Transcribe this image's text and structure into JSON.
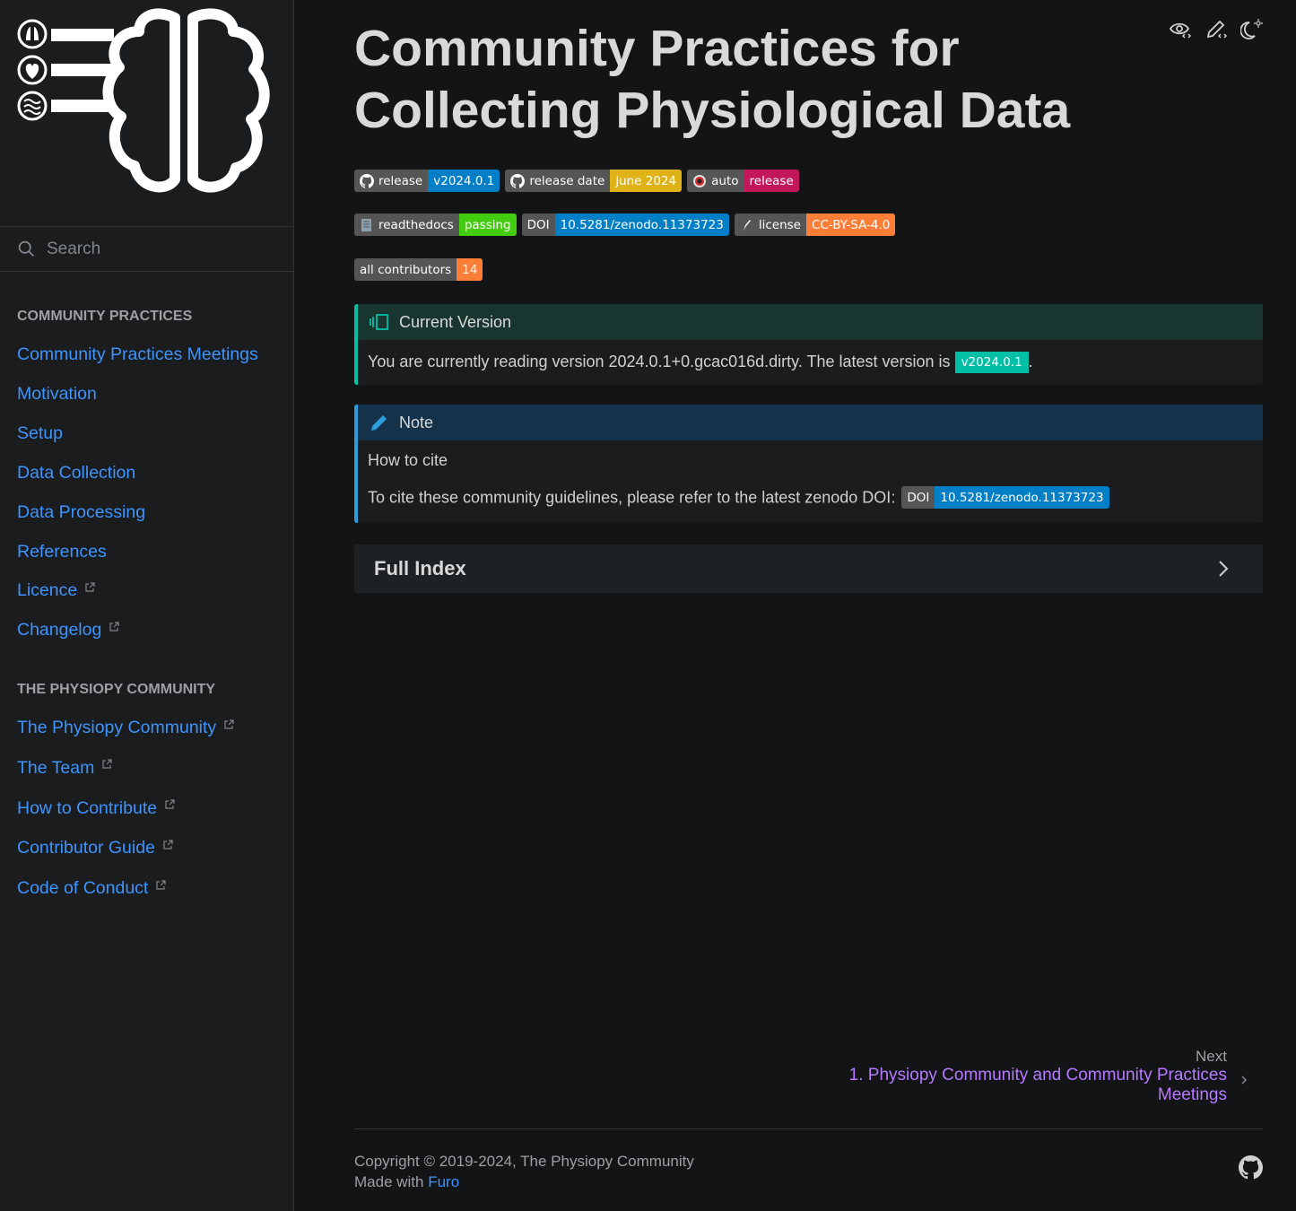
{
  "sidebar": {
    "search_placeholder": "Search",
    "caption1": "COMMUNITY PRACTICES",
    "section1": [
      {
        "label": "Community Practices Meetings",
        "external": false
      },
      {
        "label": "Motivation",
        "external": false
      },
      {
        "label": "Setup",
        "external": false
      },
      {
        "label": "Data Collection",
        "external": false
      },
      {
        "label": "Data Processing",
        "external": false
      },
      {
        "label": "References",
        "external": false
      },
      {
        "label": "Licence",
        "external": true
      },
      {
        "label": "Changelog",
        "external": true
      }
    ],
    "caption2": "THE PHYSIOPY COMMUNITY",
    "section2": [
      {
        "label": "The Physiopy Community",
        "external": true
      },
      {
        "label": "The Team",
        "external": true
      },
      {
        "label": "How to Contribute",
        "external": true
      },
      {
        "label": "Contributor Guide",
        "external": true
      },
      {
        "label": "Code of Conduct",
        "external": true
      }
    ]
  },
  "page": {
    "title_line1": "Community Practices for",
    "title_line2": "Collecting Physiological Data"
  },
  "badges": {
    "row1": [
      {
        "label": "release",
        "value": "v2024.0.1",
        "value_color": "#007ec6",
        "icon": "github-icon"
      },
      {
        "label": "release date",
        "value": "june 2024",
        "value_color": "#dfb317",
        "icon": "github-icon"
      },
      {
        "label": "auto",
        "value": "release",
        "value_color": "#c2185b",
        "icon": "auto-icon"
      }
    ],
    "row2": [
      {
        "label": "readthedocs",
        "value": "passing",
        "value_color": "#4c1",
        "icon": "readthedocs-icon"
      },
      {
        "label": "DOI",
        "value": "10.5281/zenodo.11373723",
        "value_color": "#007ec6",
        "icon": ""
      },
      {
        "label": "license",
        "value": "CC-BY-SA-4.0",
        "value_color": "#fe7d37",
        "icon": "pen-icon"
      }
    ],
    "row3": [
      {
        "label": "all contributors",
        "value": "14",
        "value_color": "#fe7d37",
        "icon": ""
      }
    ]
  },
  "current_version": {
    "title": "Current Version",
    "text": "You are currently reading version 2024.0.1+0.gcac016d.dirty. The latest version is ",
    "tag": "v2024.0.1",
    "trailing": ".",
    "accent": "#00bfa5",
    "header_bg": "#18362f"
  },
  "note": {
    "title": "Note",
    "line1": "How to cite",
    "line2": "To cite these community guidelines, please refer to the latest zenodo DOI:",
    "doi_label": "DOI",
    "doi_value": "10.5281/zenodo.11373723",
    "accent": "#2d9cdb",
    "header_bg": "#14334a"
  },
  "index": {
    "label": "Full Index"
  },
  "next": {
    "label": "Next",
    "link_line1": "1. Physiopy Community and Community Practices",
    "link_line2": "Meetings"
  },
  "footer": {
    "copyright": "Copyright © 2019-2024, The Physiopy Community",
    "made_with": "Made with ",
    "furo": "Furo"
  }
}
